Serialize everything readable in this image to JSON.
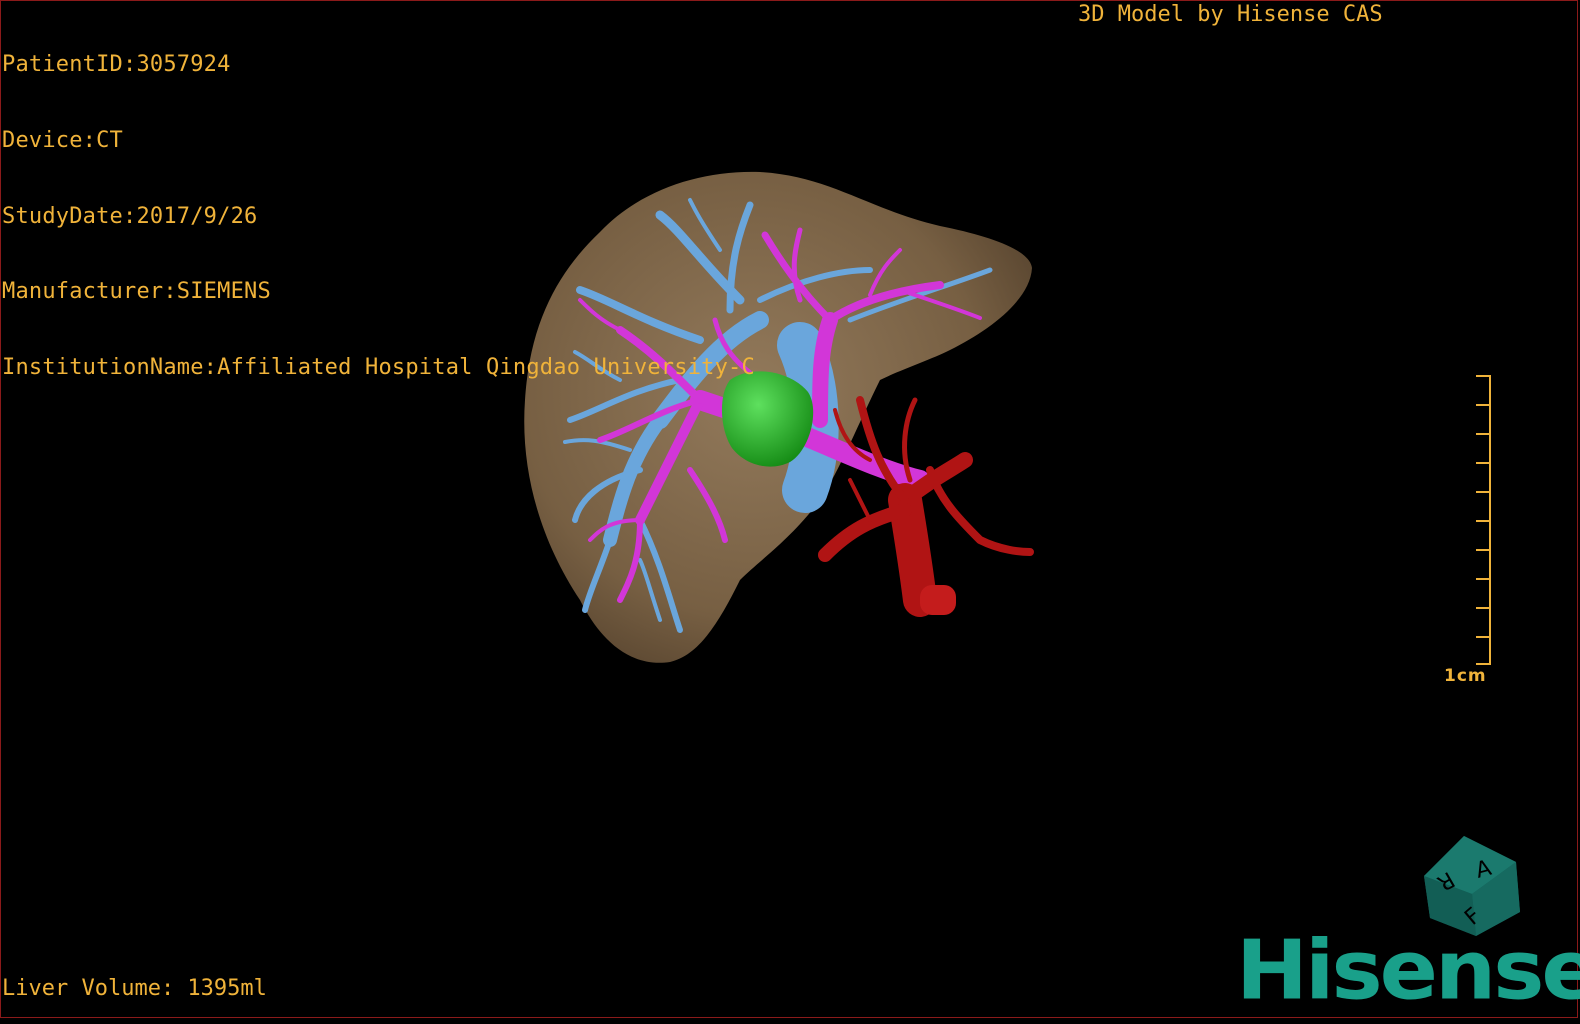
{
  "study_info": {
    "patient_id": "PatientID:3057924",
    "device": "Device:CT",
    "study_date": "StudyDate:2017/9/26",
    "manufacturer": "Manufacturer:SIEMENS",
    "institution": "InstitutionName:Affiliated Hospital Qingdao University-C"
  },
  "credit": "3D Model by Hisense CAS",
  "liver_volume": "Liver Volume: 1395ml",
  "scale_bar": {
    "label": "1cm"
  },
  "orientation_cube": {
    "faces": [
      "A",
      "R",
      "F"
    ],
    "icon": "orientation-cube-icon"
  },
  "brand": "Hisense",
  "colors": {
    "overlay_text": "#f0b33a",
    "liver": "#8a7050",
    "portal_vein": "#d236d8",
    "hepatic_vein": "#6aa6dc",
    "artery": "#b01414",
    "tumor": "#2cbc2c",
    "brand": "#19a08a",
    "background": "#000000"
  },
  "model_structures": [
    "liver",
    "hepatic-vein",
    "portal-vein",
    "hepatic-artery",
    "tumor"
  ]
}
